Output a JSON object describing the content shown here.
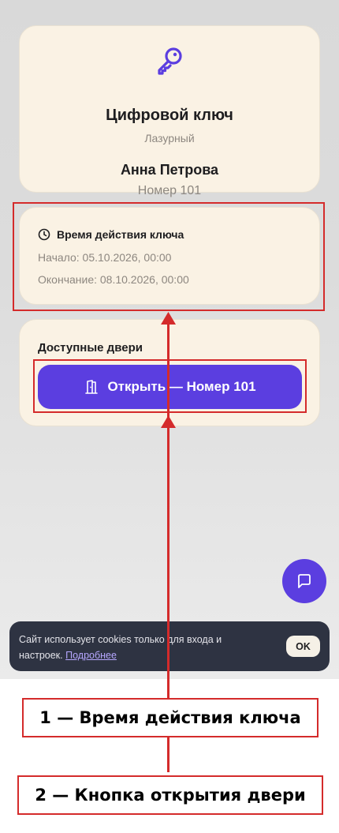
{
  "key_card": {
    "icon": "key-icon",
    "title": "Цифровой ключ",
    "subtitle": "Лазурный",
    "guest_name": "Анна Петрова",
    "room": "Номер 101"
  },
  "validity": {
    "icon": "clock-icon",
    "title": "Время действия ключа",
    "start": "Начало: 05.10.2026, 00:00",
    "end": "Окончание: 08.10.2026, 00:00"
  },
  "doors": {
    "title": "Доступные двери",
    "open_button": {
      "icon": "door-icon",
      "label": "Открыть — Номер 101"
    }
  },
  "chat": {
    "icon": "chat-icon"
  },
  "cookie_banner": {
    "text": "Сайт использует cookies только для входа и настроек.",
    "link": "Подробнее",
    "ok_button": "OK"
  },
  "annotations": {
    "label_1": "1 — Время действия ключа",
    "label_2": "2 — Кнопка открытия двери"
  },
  "colors": {
    "accent": "#5b3ee0",
    "card_bg": "#faf2e4",
    "highlight": "#d42b2b",
    "cookie_bg": "#2e3342"
  }
}
